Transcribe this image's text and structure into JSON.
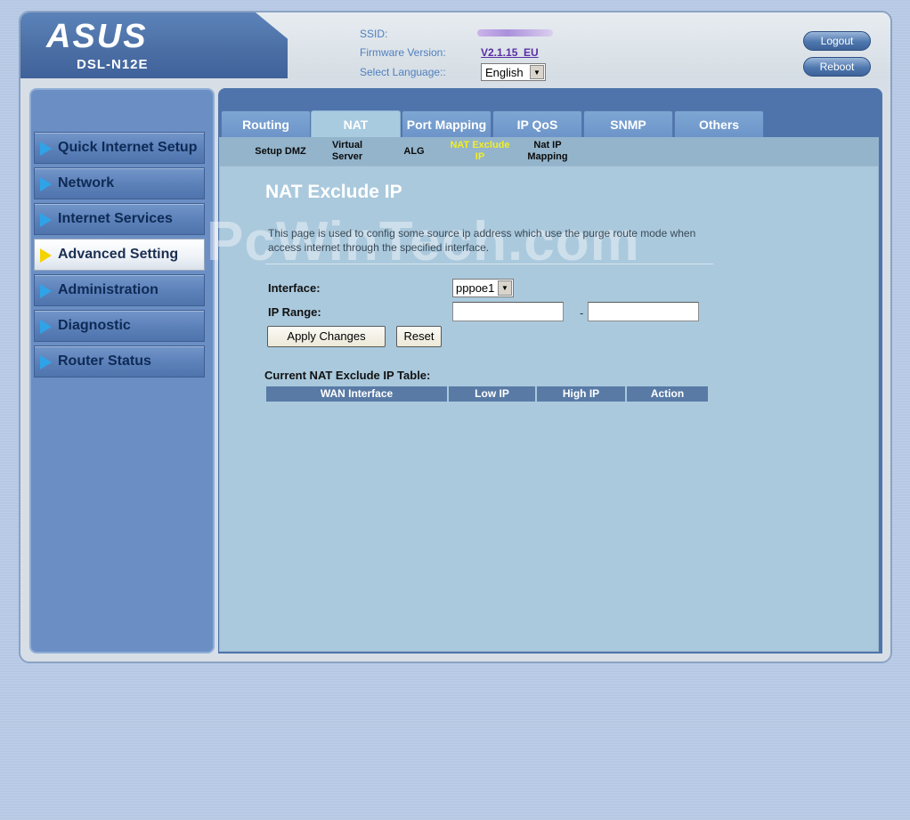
{
  "header": {
    "brand": "ASUS",
    "model": "DSL-N12E",
    "ssid_label": "SSID:",
    "firmware_label": "Firmware Version:",
    "firmware_value": "V2.1.15_EU",
    "language_label": "Select Language::",
    "language_value": "English",
    "logout_label": "Logout",
    "reboot_label": "Reboot"
  },
  "sidebar": {
    "items": [
      {
        "label": "Quick Internet Setup"
      },
      {
        "label": "Network"
      },
      {
        "label": "Internet Services"
      },
      {
        "label": "Advanced Setting"
      },
      {
        "label": "Administration"
      },
      {
        "label": "Diagnostic"
      },
      {
        "label": "Router Status"
      }
    ]
  },
  "tabs": [
    {
      "label": "Routing"
    },
    {
      "label": "NAT"
    },
    {
      "label": "Port Mapping"
    },
    {
      "label": "IP QoS"
    },
    {
      "label": "SNMP"
    },
    {
      "label": "Others"
    }
  ],
  "subnav": [
    {
      "label": "Setup DMZ"
    },
    {
      "label": "Virtual Server"
    },
    {
      "label": "ALG"
    },
    {
      "label": "NAT Exclude IP"
    },
    {
      "label": "Nat IP Mapping"
    }
  ],
  "main": {
    "title": "NAT Exclude IP",
    "watermark": "PcWinTech.com",
    "description": "This page is used to config some source ip address which use the purge route mode when access internet through the specified interface.",
    "interface_label": "Interface:",
    "interface_value": "pppoe1",
    "ip_range_label": "IP Range:",
    "ip_range_start": "",
    "ip_range_end": "",
    "dash": "-",
    "apply_label": "Apply Changes",
    "reset_label": "Reset",
    "table_title": "Current NAT Exclude IP Table:",
    "table_headers": [
      "WAN Interface",
      "Low IP",
      "High IP",
      "Action"
    ]
  }
}
